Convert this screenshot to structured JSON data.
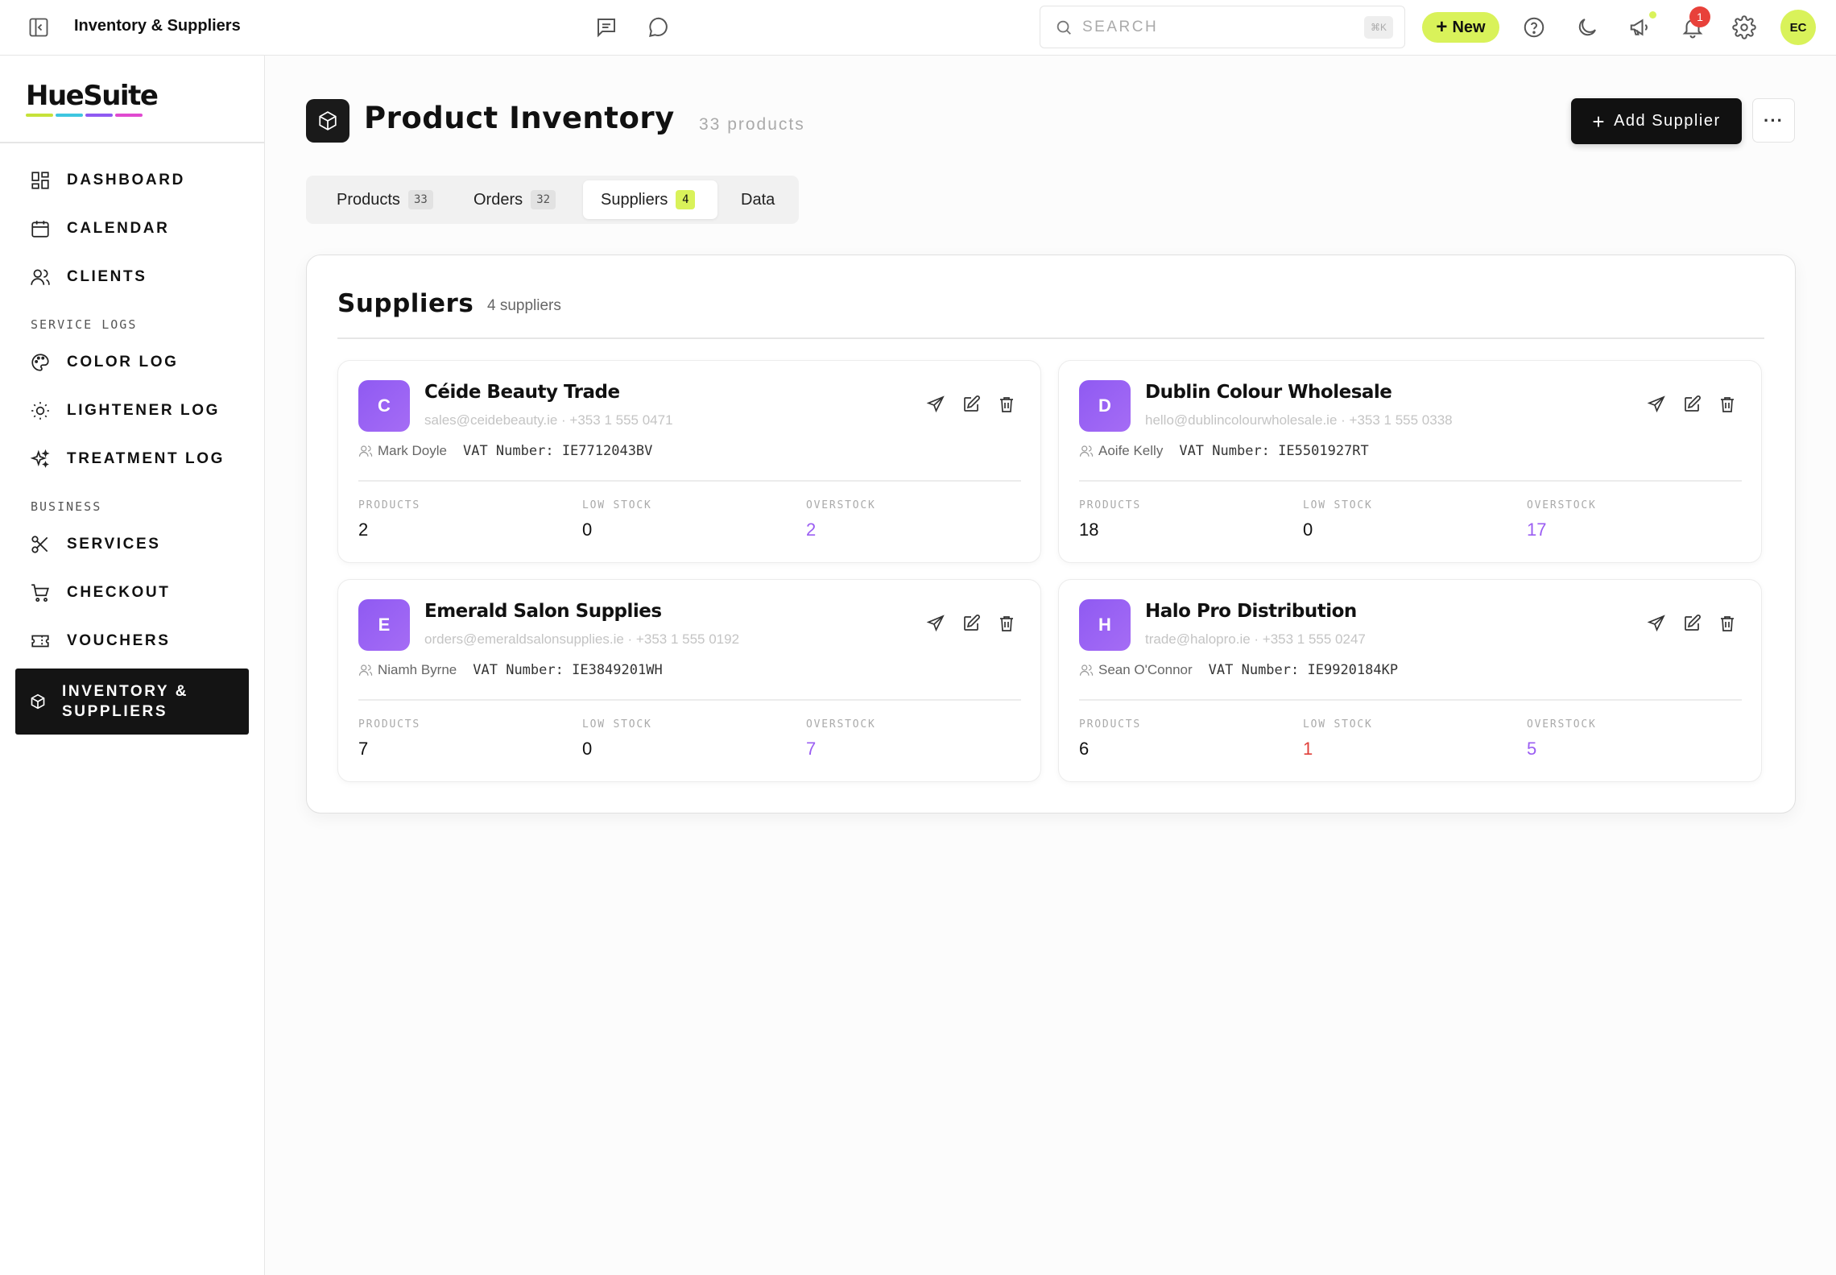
{
  "topbar": {
    "title": "Inventory & Suppliers",
    "search_placeholder": "SEARCH",
    "search_shortcut": "⌘K",
    "new_label": "New",
    "notification_count": "1",
    "user_initials": "EC",
    "accent": "#d9f25a"
  },
  "sidebar": {
    "logo": "HueSuite",
    "logo_colors": [
      "#c6e23a",
      "#3ec6e0",
      "#8f5af2",
      "#e04ad0"
    ],
    "items": [
      {
        "label": "DASHBOARD",
        "icon": "dashboard-icon"
      },
      {
        "label": "CALENDAR",
        "icon": "calendar-icon"
      },
      {
        "label": "CLIENTS",
        "icon": "users-icon"
      },
      {
        "label": "COLOR LOG",
        "icon": "palette-icon"
      },
      {
        "label": "LIGHTENER LOG",
        "icon": "sun-icon"
      },
      {
        "label": "TREATMENT LOG",
        "icon": "sparkles-icon"
      },
      {
        "label": "SERVICES",
        "icon": "scissors-icon"
      },
      {
        "label": "CHECKOUT",
        "icon": "cart-icon"
      },
      {
        "label": "VOUCHERS",
        "icon": "ticket-icon"
      },
      {
        "label": "INVENTORY & SUPPLIERS",
        "icon": "box-icon",
        "active": true
      }
    ],
    "sections": {
      "service_logs": "SERVICE LOGS",
      "business": "BUSINESS"
    }
  },
  "page": {
    "title": "Product Inventory",
    "count": "33 products",
    "add_supplier_label": "Add Supplier"
  },
  "tabs": [
    {
      "label": "Products",
      "badge": "33"
    },
    {
      "label": "Orders",
      "badge": "32"
    },
    {
      "label": "Suppliers",
      "badge": "4",
      "active": true
    },
    {
      "label": "Data",
      "badge": ""
    }
  ],
  "suppliers_panel": {
    "title": "Suppliers",
    "subtitle": "4 suppliers",
    "stat_labels": {
      "products": "PRODUCTS",
      "low_stock": "LOW STOCK",
      "overstock": "OVERSTOCK"
    },
    "vat_prefix": "VAT Number:",
    "cards": [
      {
        "initial": "C",
        "name": "Céide Beauty Trade",
        "contact": "sales@ceidebeauty.ie · +353 1 555 0471",
        "person": "Mark Doyle",
        "vat": "IE7712043BV",
        "products": "2",
        "low_stock": "0",
        "overstock": "2"
      },
      {
        "initial": "D",
        "name": "Dublin Colour Wholesale",
        "contact": "hello@dublincolourwholesale.ie · +353 1 555 0338",
        "person": "Aoife Kelly",
        "vat": "IE5501927RT",
        "products": "18",
        "low_stock": "0",
        "overstock": "17"
      },
      {
        "initial": "E",
        "name": "Emerald Salon Supplies",
        "contact": "orders@emeraldsalonsupplies.ie · +353 1 555 0192",
        "person": "Niamh Byrne",
        "vat": "IE3849201WH",
        "products": "7",
        "low_stock": "0",
        "overstock": "7"
      },
      {
        "initial": "H",
        "name": "Halo Pro Distribution",
        "contact": "trade@halopro.ie · +353 1 555 0247",
        "person": "Sean O'Connor",
        "vat": "IE9920184KP",
        "products": "6",
        "low_stock": "1",
        "overstock": "5"
      }
    ]
  }
}
